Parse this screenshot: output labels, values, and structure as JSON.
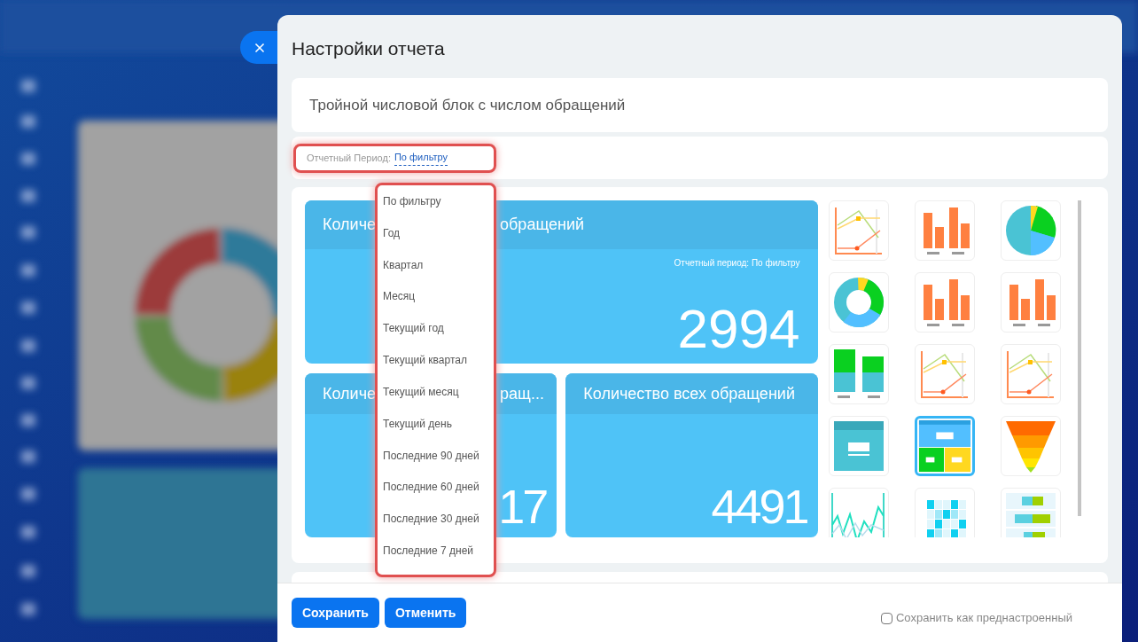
{
  "dialog": {
    "title": "Настройки отчета"
  },
  "report_name": {
    "value": "Тройной числовой блок с числом обращений"
  },
  "period": {
    "label": "Отчетный Период:",
    "value": "По фильтру",
    "highlighted": true
  },
  "period_menu": {
    "highlighted": true,
    "items": [
      "По фильтру",
      "Год",
      "Квартал",
      "Месяц",
      "Текущий год",
      "Текущий квартал",
      "Текущий месяц",
      "Текущий день",
      "Последние 90 дней",
      "Последние 60 дней",
      "Последние 30 дней",
      "Последние 7 дней"
    ]
  },
  "tiles": [
    {
      "title_start": "Количе",
      "title_end": "обращений",
      "caption": "Отчетный период: По фильтру",
      "value": "2994"
    },
    {
      "title_start": "Количе",
      "title_end": "ращ...",
      "value": "17"
    },
    {
      "title": "Количество всех обращений",
      "value": "4491"
    }
  ],
  "chart_types": [
    {
      "kind": "line",
      "selected": false
    },
    {
      "kind": "bar",
      "selected": false
    },
    {
      "kind": "pie",
      "selected": false
    },
    {
      "kind": "donut",
      "selected": false
    },
    {
      "kind": "bar",
      "selected": false
    },
    {
      "kind": "bar",
      "selected": false
    },
    {
      "kind": "stacked",
      "selected": false
    },
    {
      "kind": "line",
      "selected": false
    },
    {
      "kind": "line",
      "selected": false
    },
    {
      "kind": "number",
      "selected": false
    },
    {
      "kind": "triple",
      "selected": true
    },
    {
      "kind": "funnel",
      "selected": false
    },
    {
      "kind": "wave",
      "selected": false
    },
    {
      "kind": "heatmap",
      "selected": false
    },
    {
      "kind": "hbar",
      "selected": false
    }
  ],
  "buttons": [
    {
      "label": "Сохранить"
    },
    {
      "label": "Отменить"
    }
  ],
  "save_preset": {
    "label": "Сохранить как преднастроенный",
    "checked": false
  }
}
